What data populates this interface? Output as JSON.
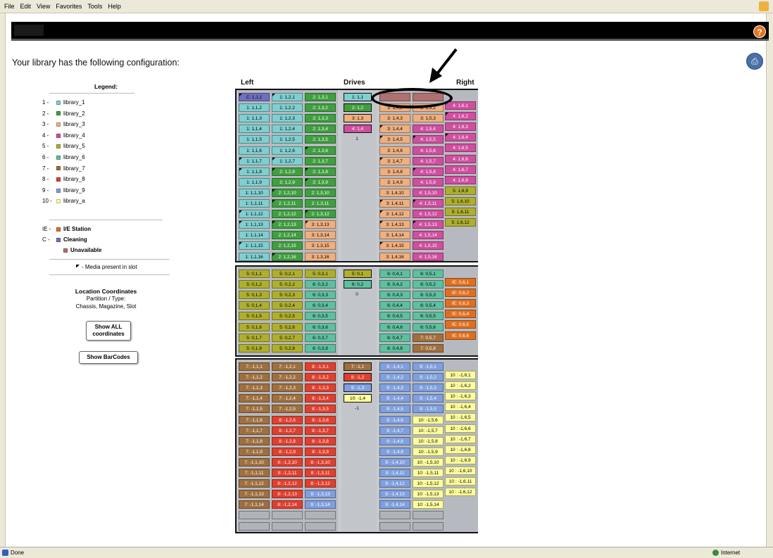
{
  "menu": [
    "File",
    "Edit",
    "View",
    "Favorites",
    "Tools",
    "Help"
  ],
  "help_label": "?",
  "title": "Your library has the following configuration:",
  "legend": {
    "title": "Legend:",
    "items": [
      {
        "num": "1 -",
        "label": "library_1",
        "color": "#7fcfcf"
      },
      {
        "num": "2 -",
        "label": "library_2",
        "color": "#3f9f3f"
      },
      {
        "num": "3 -",
        "label": "library_3",
        "color": "#efaf7f"
      },
      {
        "num": "4 -",
        "label": "library_4",
        "color": "#cf4f9f"
      },
      {
        "num": "5 -",
        "label": "library_5",
        "color": "#afaf2f"
      },
      {
        "num": "6 -",
        "label": "library_6",
        "color": "#5fbf9f"
      },
      {
        "num": "7 -",
        "label": "library_7",
        "color": "#9f6f3f"
      },
      {
        "num": "8 -",
        "label": "library_8",
        "color": "#df3f2f"
      },
      {
        "num": "9 -",
        "label": "library_9",
        "color": "#7f9fdf"
      },
      {
        "num": "10 -",
        "label": "library_a",
        "color": "#ffff9f"
      }
    ],
    "ie": {
      "num": "IE -",
      "label": "I/E Station",
      "color": "#df6f1f"
    },
    "cleaning": {
      "num": "C -",
      "label": "Cleaning",
      "color": "#6f6fbf"
    },
    "unavailable": {
      "label": "Unavailable",
      "color": "#b07070"
    },
    "media": "- Media present in slot",
    "coords_title": "Location Coordinates",
    "coords_l1": "Partition / Type:",
    "coords_l2": "Chassis, Magazine, Slot"
  },
  "buttons": {
    "show_all": "Show ALL coordinates",
    "show_barcodes": "Show BarCodes"
  },
  "headers": {
    "left": "Left",
    "drives": "Drives",
    "right": "Right"
  },
  "status": {
    "left": "Done",
    "right": "Internet"
  },
  "colors": {
    "1": "#7fcfcf",
    "2": "#3f9f3f",
    "3": "#efaf7f",
    "4": "#cf4f9f",
    "5": "#afaf2f",
    "6": "#5fbf9f",
    "7": "#9f6f3f",
    "8": "#df3f2f",
    "9": "#7f9fdf",
    "10": "#ffff9f",
    "IE": "#df6f1f",
    "C": "#6f6fbf",
    "U": "#b07070",
    "E": "#b0b4ba"
  },
  "sections": [
    {
      "columns": [
        {
          "slots": [
            "C: 1,1,1*",
            "1: 1,1,2",
            "1: 1,1,3",
            "1: 1,1,4",
            "1: 1,1,5",
            "1: 1,1,6",
            "1: 1,1,7*",
            "1: 1,1,8*",
            "1: 1,1,9",
            "1: 1,1,10",
            "1: 1,1,11",
            "1: 1,1,12*",
            "1: 1,1,13*",
            "1: 1,1,14",
            "1: 1,1,15*",
            "1: 1,1,16"
          ]
        },
        {
          "slots": [
            "1: 1,2,1*",
            "1: 1,2,2",
            "1: 1,2,3",
            "1: 1,2,4",
            "1: 1,2,5",
            "1: 1,2,6",
            "1: 1,2,7*",
            "2: 1,2,8*",
            "2: 1,2,9",
            "2: 1,2,10*",
            "2: 1,2,11*",
            "2: 1,2,12",
            "2: 1,2,13*",
            "2: 1,2,14",
            "2: 1,2,15",
            "2: 1,2,16*"
          ]
        },
        {
          "slots": [
            "2: 1,3,1",
            "2: 1,3,2",
            "2: 1,3,3",
            "2: 1,3,4",
            "2: 1,3,5",
            "2: 1,3,6*",
            "2: 1,3,7",
            "2: 1,3,8*",
            "2: 1,3,9*",
            "2: 1,3,10",
            "2: 1,3,11",
            "2: 1,3,12*",
            "3: 1,3,13*",
            "3: 1,3,14",
            "3: 1,3,15",
            "3: 1,3,16"
          ]
        }
      ],
      "drives": [
        {
          "label": "1: 1,1"
        },
        {
          "label": "2: 1,2"
        },
        {
          "label": "3: 1,3"
        },
        {
          "label": "4: 1,4"
        }
      ],
      "drive_num": "1",
      "right_columns": [
        {
          "slots": [
            "U",
            "3: 1,4,2",
            "3: 1,4,3",
            "3: 1,4,4*",
            "3: 1,4,5*",
            "3: 1,4,6",
            "3: 1,4,7*",
            "3: 1,4,8",
            "3: 1,4,9",
            "3: 1,4,10",
            "3: 1,4,11*",
            "3: 1,4,12*",
            "3: 1,4,13*",
            "3: 1,4,14",
            "3: 1,4,15*",
            "3: 1,4,16"
          ]
        },
        {
          "slots": [
            "U",
            "3: 1,5,2",
            "3: 1,5,3",
            "4: 1,5,4",
            "4: 1,5,5*",
            "4: 1,5,6",
            "4: 1,5,7",
            "4: 1,5,8*",
            "4: 1,5,9",
            "4: 1,5,10",
            "4: 1,5,11*",
            "4: 1,5,12",
            "4: 1,5,13*",
            "4: 1,5,14",
            "4: 1,5,15",
            "4: 1,5,16"
          ]
        },
        {
          "slots": [
            "4: 1,6,1*",
            "4: 1,6,2*",
            "4: 1,6,3",
            "4: 1,6,4*",
            "4: 1,6,5",
            "4: 1,6,6",
            "4: 1,6,7",
            "4: 1,6,8",
            "5: 1,6,9",
            "5: 1,6,10",
            "5: 1,6,11",
            "5: 1,6,12"
          ]
        }
      ]
    },
    {
      "columns": [
        {
          "slots": [
            "5: 0,1,1",
            "5: 0,1,2",
            "5: 0,1,3",
            "5: 0,1,4",
            "5: 0,1,5",
            "5: 0,1,6",
            "5: 0,1,7",
            "5: 0,1,8"
          ]
        },
        {
          "slots": [
            "5: 0,2,1",
            "5: 0,2,2",
            "5: 0,2,3",
            "5: 0,2,4",
            "5: 0,2,5",
            "5: 0,2,6",
            "5: 0,2,7",
            "5: 0,2,8"
          ]
        },
        {
          "slots": [
            "5: 0,3,1",
            "6: 0,3,2",
            "6: 0,3,3",
            "6: 0,3,4",
            "6: 0,3,5",
            "6: 0,3,6",
            "6: 0,3,7",
            "6: 0,3,8"
          ]
        }
      ],
      "drives": [
        {
          "label": "5: 0,1"
        },
        {
          "label": "6: 0,2"
        }
      ],
      "drive_num": "0",
      "right_columns": [
        {
          "slots": [
            "6: 0,4,1",
            "6: 0,4,2",
            "6: 0,4,3",
            "6: 0,4,4",
            "6: 0,4,5",
            "6: 0,4,6",
            "6: 0,4,7",
            "6: 0,4,8"
          ]
        },
        {
          "slots": [
            "6: 0,5,1",
            "6: 0,5,2",
            "6: 0,5,3",
            "6: 0,5,4",
            "6: 0,5,5",
            "6: 0,5,6",
            "7: 0,5,7",
            "7: 0,5,8"
          ]
        },
        {
          "slots": [
            "IE: 0,6,1",
            "IE: 0,6,2",
            "IE: 0,6,3",
            "IE: 0,6,4",
            "IE: 0,6,5",
            "IE: 0,6,6"
          ]
        }
      ]
    },
    {
      "columns": [
        {
          "slots": [
            "7: -1,1,1",
            "7: -1,1,2",
            "7: -1,1,3",
            "7: -1,1,4",
            "7: -1,1,5",
            "7: -1,1,6",
            "7: -1,1,7",
            "7: -1,1,8",
            "7: -1,1,9",
            "7: -1,1,10",
            "7: -1,1,11",
            "7: -1,1,12",
            "7: -1,1,13",
            "7: -1,1,14",
            "E",
            "E"
          ]
        },
        {
          "slots": [
            "7: -1,2,1",
            "7: -1,2,2",
            "7: -1,2,3",
            "7: -1,2,4",
            "7: -1,2,5",
            "8: -1,2,6",
            "8: -1,2,7",
            "8: -1,2,8",
            "8: -1,2,9",
            "8: -1,2,10",
            "8: -1,2,11",
            "8: -1,2,12",
            "8: -1,2,13",
            "8: -1,2,14",
            "E",
            "E"
          ]
        },
        {
          "slots": [
            "8: -1,3,1",
            "8: -1,3,2",
            "8: -1,3,3",
            "8: -1,3,4",
            "8: -1,3,5",
            "8: -1,3,6",
            "8: -1,3,7",
            "8: -1,3,8",
            "8: -1,3,9",
            "8: -1,3,10",
            "8: -1,3,11",
            "8: -1,3,12",
            "9: -1,3,13",
            "9: -1,3,14",
            "E",
            "E"
          ]
        }
      ],
      "drives": [
        {
          "label": "7: -1,1"
        },
        {
          "label": "8: -1,2"
        },
        {
          "label": "9: -1,3"
        },
        {
          "label": "10: -1,4"
        }
      ],
      "drive_num": "-1",
      "right_columns": [
        {
          "slots": [
            "9: -1,4,1",
            "9: -1,4,2",
            "9: -1,4,3",
            "9: -1,4,4",
            "9: -1,4,5",
            "9: -1,4,6",
            "9: -1,4,7",
            "9: -1,4,8",
            "9: -1,4,9",
            "9: -1,4,10",
            "9: -1,4,11",
            "9: -1,4,12",
            "9: -1,4,13",
            "9: -1,4,14",
            "E",
            "E"
          ]
        },
        {
          "slots": [
            "9: -1,5,1",
            "9: -1,5,2",
            "9: -1,5,3",
            "9: -1,5,4",
            "9: -1,5,5",
            "10: -1,5,6",
            "10: -1,5,7",
            "10: -1,5,8",
            "10: -1,5,9",
            "10: -1,5,10",
            "10: -1,5,11",
            "10: -1,5,12",
            "10: -1,5,13",
            "10: -1,5,14",
            "E",
            "E"
          ]
        },
        {
          "slots": [
            "10 : -1,6,1",
            "10 : -1,6,2",
            "10 : -1,6,3",
            "10 : -1,6,4",
            "10 : -1,6,5",
            "10 : -1,6,6",
            "10 : -1,6,7",
            "10 : -1,6,8",
            "10 : -1,6,9",
            "10 : -1,6,10",
            "10 : -1,6,11",
            "10 : -1,6,12"
          ]
        }
      ]
    }
  ]
}
